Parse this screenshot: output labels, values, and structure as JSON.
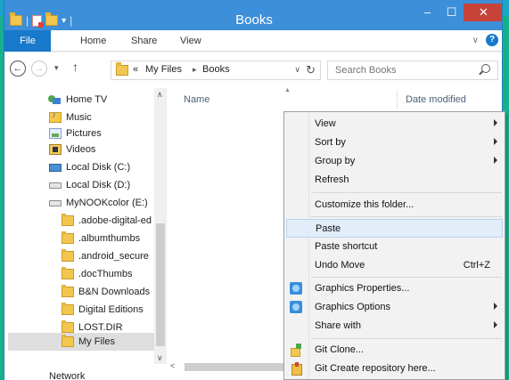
{
  "window": {
    "title": "Books",
    "controls": {
      "minimize": "–",
      "maximize": "☐",
      "close": "✕"
    },
    "accent": "#3d8fd9"
  },
  "ribbon": {
    "file": "File",
    "tabs": [
      "Home",
      "Share",
      "View"
    ],
    "expand_icon": "chevron-down-icon",
    "help": "?"
  },
  "address": {
    "back": "←",
    "forward": "→",
    "up": "↑",
    "overflow": "«",
    "crumbs": [
      "My Files",
      "Books"
    ],
    "separator": "▸",
    "search_placeholder": "Search Books"
  },
  "navpane": {
    "items": [
      {
        "label": "Home TV",
        "icon": "homegroup-icon"
      },
      {
        "label": "Music",
        "icon": "music-folder-icon"
      },
      {
        "label": "Pictures",
        "icon": "pictures-folder-icon"
      },
      {
        "label": "Videos",
        "icon": "videos-folder-icon"
      },
      {
        "label": "Local Disk (C:)",
        "icon": "local-disk-icon"
      },
      {
        "label": "Local Disk (D:)",
        "icon": "drive-icon"
      },
      {
        "label": "MyNOOKcolor (E:)",
        "icon": "drive-icon"
      },
      {
        "label": ".adobe-digital-ed",
        "icon": "folder-icon"
      },
      {
        "label": ".albumthumbs",
        "icon": "folder-icon"
      },
      {
        "label": ".android_secure",
        "icon": "folder-icon"
      },
      {
        "label": ".docThumbs",
        "icon": "folder-icon"
      },
      {
        "label": "B&N Downloads",
        "icon": "folder-icon"
      },
      {
        "label": "Digital Editions",
        "icon": "folder-icon"
      },
      {
        "label": "LOST.DIR",
        "icon": "folder-icon"
      },
      {
        "label": "My Files",
        "icon": "folder-icon",
        "selected": true
      }
    ],
    "partial_item": "Network"
  },
  "filelist": {
    "columns": [
      "Name",
      "Date modified"
    ]
  },
  "context_menu": {
    "items": [
      {
        "label": "View",
        "submenu": true
      },
      {
        "label": "Sort by",
        "submenu": true
      },
      {
        "label": "Group by",
        "submenu": true
      },
      {
        "label": "Refresh"
      },
      {
        "label": "Customize this folder..."
      },
      {
        "label": "Paste",
        "hover": true
      },
      {
        "label": "Paste shortcut"
      },
      {
        "label": "Undo Move",
        "shortcut": "Ctrl+Z"
      },
      {
        "label": "Graphics Properties...",
        "icon": "graphics-icon"
      },
      {
        "label": "Graphics Options",
        "icon": "graphics-icon",
        "submenu": true
      },
      {
        "label": "Share with",
        "submenu": true
      },
      {
        "label": "Git Clone...",
        "icon": "git-clone-icon"
      },
      {
        "label": "Git Create repository here...",
        "icon": "git-repo-icon"
      }
    ]
  }
}
